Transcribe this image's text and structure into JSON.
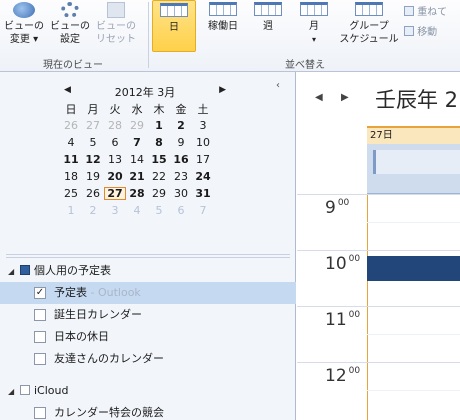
{
  "ribbon": {
    "buttons": [
      {
        "name": "change-view",
        "line1": "ビューの",
        "line2": "変更 ▾"
      },
      {
        "name": "view-settings",
        "line1": "ビューの",
        "line2": "設定"
      },
      {
        "name": "reset-view",
        "line1": "ビューの",
        "line2": "リセット"
      }
    ],
    "arrange_buttons": [
      {
        "name": "day",
        "line1": "日",
        "line2": ""
      },
      {
        "name": "work-week",
        "line1": "稼働日",
        "line2": ""
      },
      {
        "name": "week",
        "line1": "週",
        "line2": ""
      },
      {
        "name": "month",
        "line1": "月",
        "line2": "▾"
      },
      {
        "name": "schedule-view",
        "line1": "グループ",
        "line2": "スケジュール"
      }
    ],
    "overlay_label": "重ねて",
    "move_label": "移動",
    "group_current_view": "現在のビュー",
    "group_arrange": "並べ替え"
  },
  "mini_calendar": {
    "title": "2012年 3月",
    "prev": "◀",
    "next": "▶",
    "weekdays": [
      "日",
      "月",
      "火",
      "水",
      "木",
      "金",
      "土"
    ],
    "weeks": [
      [
        {
          "d": "26",
          "s": "gray"
        },
        {
          "d": "27",
          "s": "gray"
        },
        {
          "d": "28",
          "s": "gray"
        },
        {
          "d": "29",
          "s": "gray"
        },
        {
          "d": "1",
          "s": "bold"
        },
        {
          "d": "2",
          "s": "bold"
        },
        {
          "d": "3",
          "s": ""
        }
      ],
      [
        {
          "d": "4",
          "s": ""
        },
        {
          "d": "5",
          "s": ""
        },
        {
          "d": "6",
          "s": ""
        },
        {
          "d": "7",
          "s": "bold"
        },
        {
          "d": "8",
          "s": "bold"
        },
        {
          "d": "9",
          "s": ""
        },
        {
          "d": "10",
          "s": ""
        }
      ],
      [
        {
          "d": "11",
          "s": "bold"
        },
        {
          "d": "12",
          "s": "bold"
        },
        {
          "d": "13",
          "s": ""
        },
        {
          "d": "14",
          "s": ""
        },
        {
          "d": "15",
          "s": "bold"
        },
        {
          "d": "16",
          "s": "bold"
        },
        {
          "d": "17",
          "s": ""
        }
      ],
      [
        {
          "d": "18",
          "s": ""
        },
        {
          "d": "19",
          "s": ""
        },
        {
          "d": "20",
          "s": "bold"
        },
        {
          "d": "21",
          "s": "bold"
        },
        {
          "d": "22",
          "s": ""
        },
        {
          "d": "23",
          "s": ""
        },
        {
          "d": "24",
          "s": "bold"
        }
      ],
      [
        {
          "d": "25",
          "s": ""
        },
        {
          "d": "26",
          "s": ""
        },
        {
          "d": "27",
          "s": "today bold"
        },
        {
          "d": "28",
          "s": "bold"
        },
        {
          "d": "29",
          "s": ""
        },
        {
          "d": "30",
          "s": ""
        },
        {
          "d": "31",
          "s": "bold"
        }
      ],
      [
        {
          "d": "1",
          "s": "light"
        },
        {
          "d": "2",
          "s": "light"
        },
        {
          "d": "3",
          "s": "light"
        },
        {
          "d": "4",
          "s": "light"
        },
        {
          "d": "5",
          "s": "light"
        },
        {
          "d": "6",
          "s": "light"
        },
        {
          "d": "7",
          "s": "light"
        }
      ]
    ]
  },
  "collapse_glyph": "‹",
  "my_calendars": {
    "title": "個人用の予定表",
    "items": [
      {
        "label": "予定表",
        "suffix": " - Outlook",
        "checked": true,
        "selected": true
      },
      {
        "label": "誕生日カレンダー",
        "suffix": "",
        "checked": false,
        "selected": false
      },
      {
        "label": "日本の休日",
        "suffix": "",
        "checked": false,
        "selected": false
      },
      {
        "label": "友達さんのカレンダー",
        "suffix": "",
        "checked": false,
        "selected": false
      }
    ]
  },
  "icloud": {
    "title": "iCloud",
    "items": [
      {
        "label": "カレンダー特会の競会",
        "suffix": "",
        "checked": false,
        "selected": false
      }
    ]
  },
  "calendar_view": {
    "prev": "◀",
    "next": "▶",
    "title": "壬辰年 2",
    "day_label": "27日",
    "hours": [
      {
        "h": "9",
        "m": "00"
      },
      {
        "h": "10",
        "m": "00"
      },
      {
        "h": "11",
        "m": "00"
      },
      {
        "h": "12",
        "m": "00"
      }
    ]
  },
  "colors": {
    "accent_today": "#e8a33b",
    "event": "#22457a",
    "selection": "#c5d9f1"
  }
}
